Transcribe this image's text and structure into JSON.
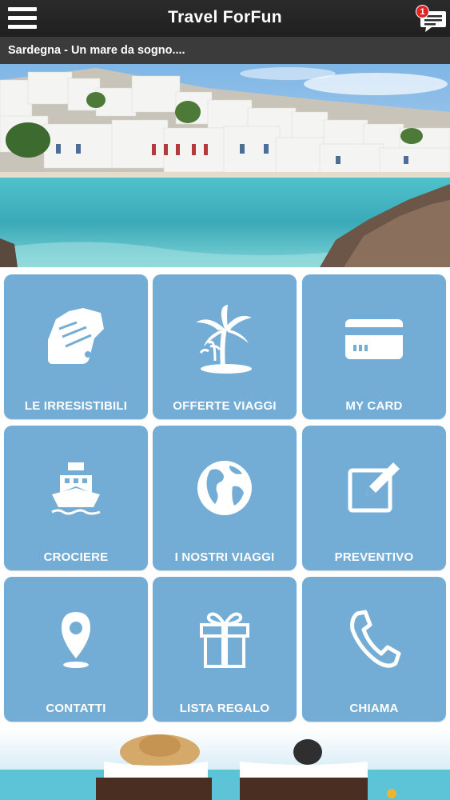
{
  "header": {
    "title": "Travel ForFun",
    "menu_icon": "hamburger-menu-icon",
    "chat_icon": "chat-bubble-icon",
    "notification_count": "1"
  },
  "ticker": {
    "text": "Sardegna - Un mare da sogno...."
  },
  "colors": {
    "topbar": "#222222",
    "ticker": "#3b3b3b",
    "tile": "#73add5",
    "badge": "#e02424"
  },
  "tiles": [
    {
      "label": "LE IRRESISTIBILI",
      "icon": "fan-swatch-icon"
    },
    {
      "label": "OFFERTE VIAGGI",
      "icon": "palm-island-icon"
    },
    {
      "label": "MY CARD",
      "icon": "credit-card-icon"
    },
    {
      "label": "CROCIERE",
      "icon": "ship-icon"
    },
    {
      "label": "I NOSTRI VIAGGI",
      "icon": "globe-icon"
    },
    {
      "label": "PREVENTIVO",
      "icon": "edit-icon"
    },
    {
      "label": "CONTATTI",
      "icon": "location-pin-icon"
    },
    {
      "label": "LISTA REGALO",
      "icon": "gift-icon"
    },
    {
      "label": "CHIAMA",
      "icon": "phone-icon"
    }
  ]
}
